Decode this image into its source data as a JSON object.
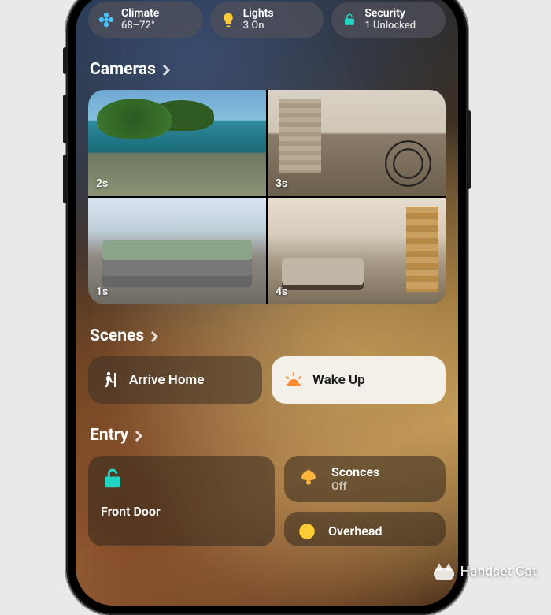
{
  "chips": {
    "climate": {
      "title": "Climate",
      "sub": "68–72°"
    },
    "lights": {
      "title": "Lights",
      "sub": "3 On"
    },
    "security": {
      "title": "Security",
      "sub": "1 Unlocked"
    }
  },
  "cameras": {
    "heading": "Cameras",
    "feeds": [
      {
        "label": "2s"
      },
      {
        "label": "3s"
      },
      {
        "label": "1s"
      },
      {
        "label": "4s"
      }
    ]
  },
  "scenes": {
    "heading": "Scenes",
    "arrive": {
      "label": "Arrive Home"
    },
    "wakeup": {
      "label": "Wake Up"
    }
  },
  "entry": {
    "heading": "Entry",
    "front_door": {
      "title": "Front Door"
    },
    "sconces": {
      "title": "Sconces",
      "sub": "Off"
    },
    "overhead": {
      "title": "Overhead"
    }
  },
  "watermark": "Handset Cat",
  "colors": {
    "fan": "#4cc4ff",
    "bulb": "#ffcc33",
    "lock": "#20d3c2",
    "sunrise": "#ff8c2e",
    "sconce": "#ffb43b"
  }
}
